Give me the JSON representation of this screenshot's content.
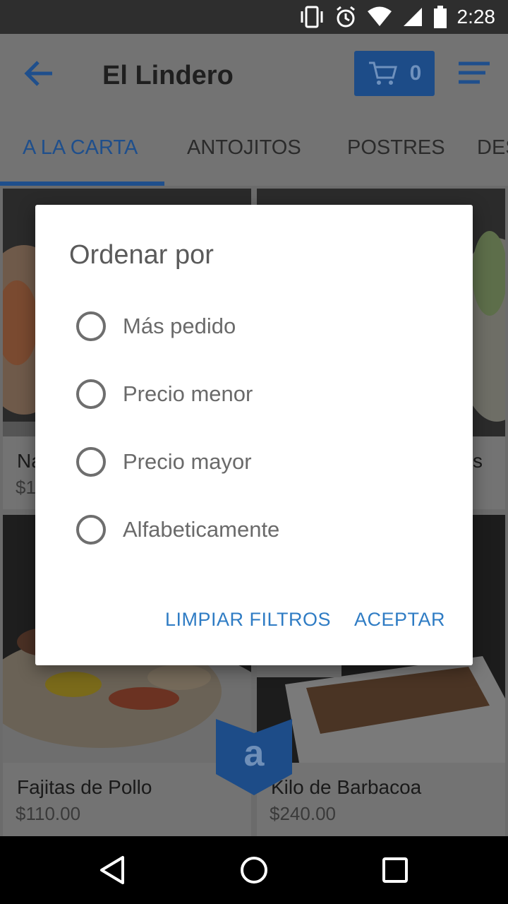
{
  "status_bar": {
    "time": "2:28",
    "icons": [
      "vibrate-icon",
      "alarm-icon",
      "wifi-icon",
      "signal-icon",
      "battery-icon"
    ]
  },
  "app_bar": {
    "title": "El Lindero",
    "cart_count": "0",
    "colors": {
      "accent": "#1f4f8c"
    }
  },
  "tabs": [
    {
      "label": "A LA CARTA",
      "active": true
    },
    {
      "label": "ANTOJITOS",
      "active": false
    },
    {
      "label": "POSTRES",
      "active": false
    },
    {
      "label": "DES",
      "active": false
    }
  ],
  "products": [
    {
      "name": "Na",
      "price": "$1"
    },
    {
      "name": "s",
      "price": ""
    },
    {
      "name": "Fajitas de Pollo",
      "price": "$110.00"
    },
    {
      "name": "Kilo de Barbacoa",
      "price": "$240.00"
    }
  ],
  "dialog": {
    "title": "Ordenar por",
    "options": [
      {
        "label": "Más pedido",
        "selected": false
      },
      {
        "label": "Precio menor",
        "selected": false
      },
      {
        "label": "Precio mayor",
        "selected": false
      },
      {
        "label": "Alfabeticamente",
        "selected": false
      }
    ],
    "clear_label": "LIMPIAR FILTROS",
    "accept_label": "ACEPTAR"
  },
  "logo_letter": "a"
}
